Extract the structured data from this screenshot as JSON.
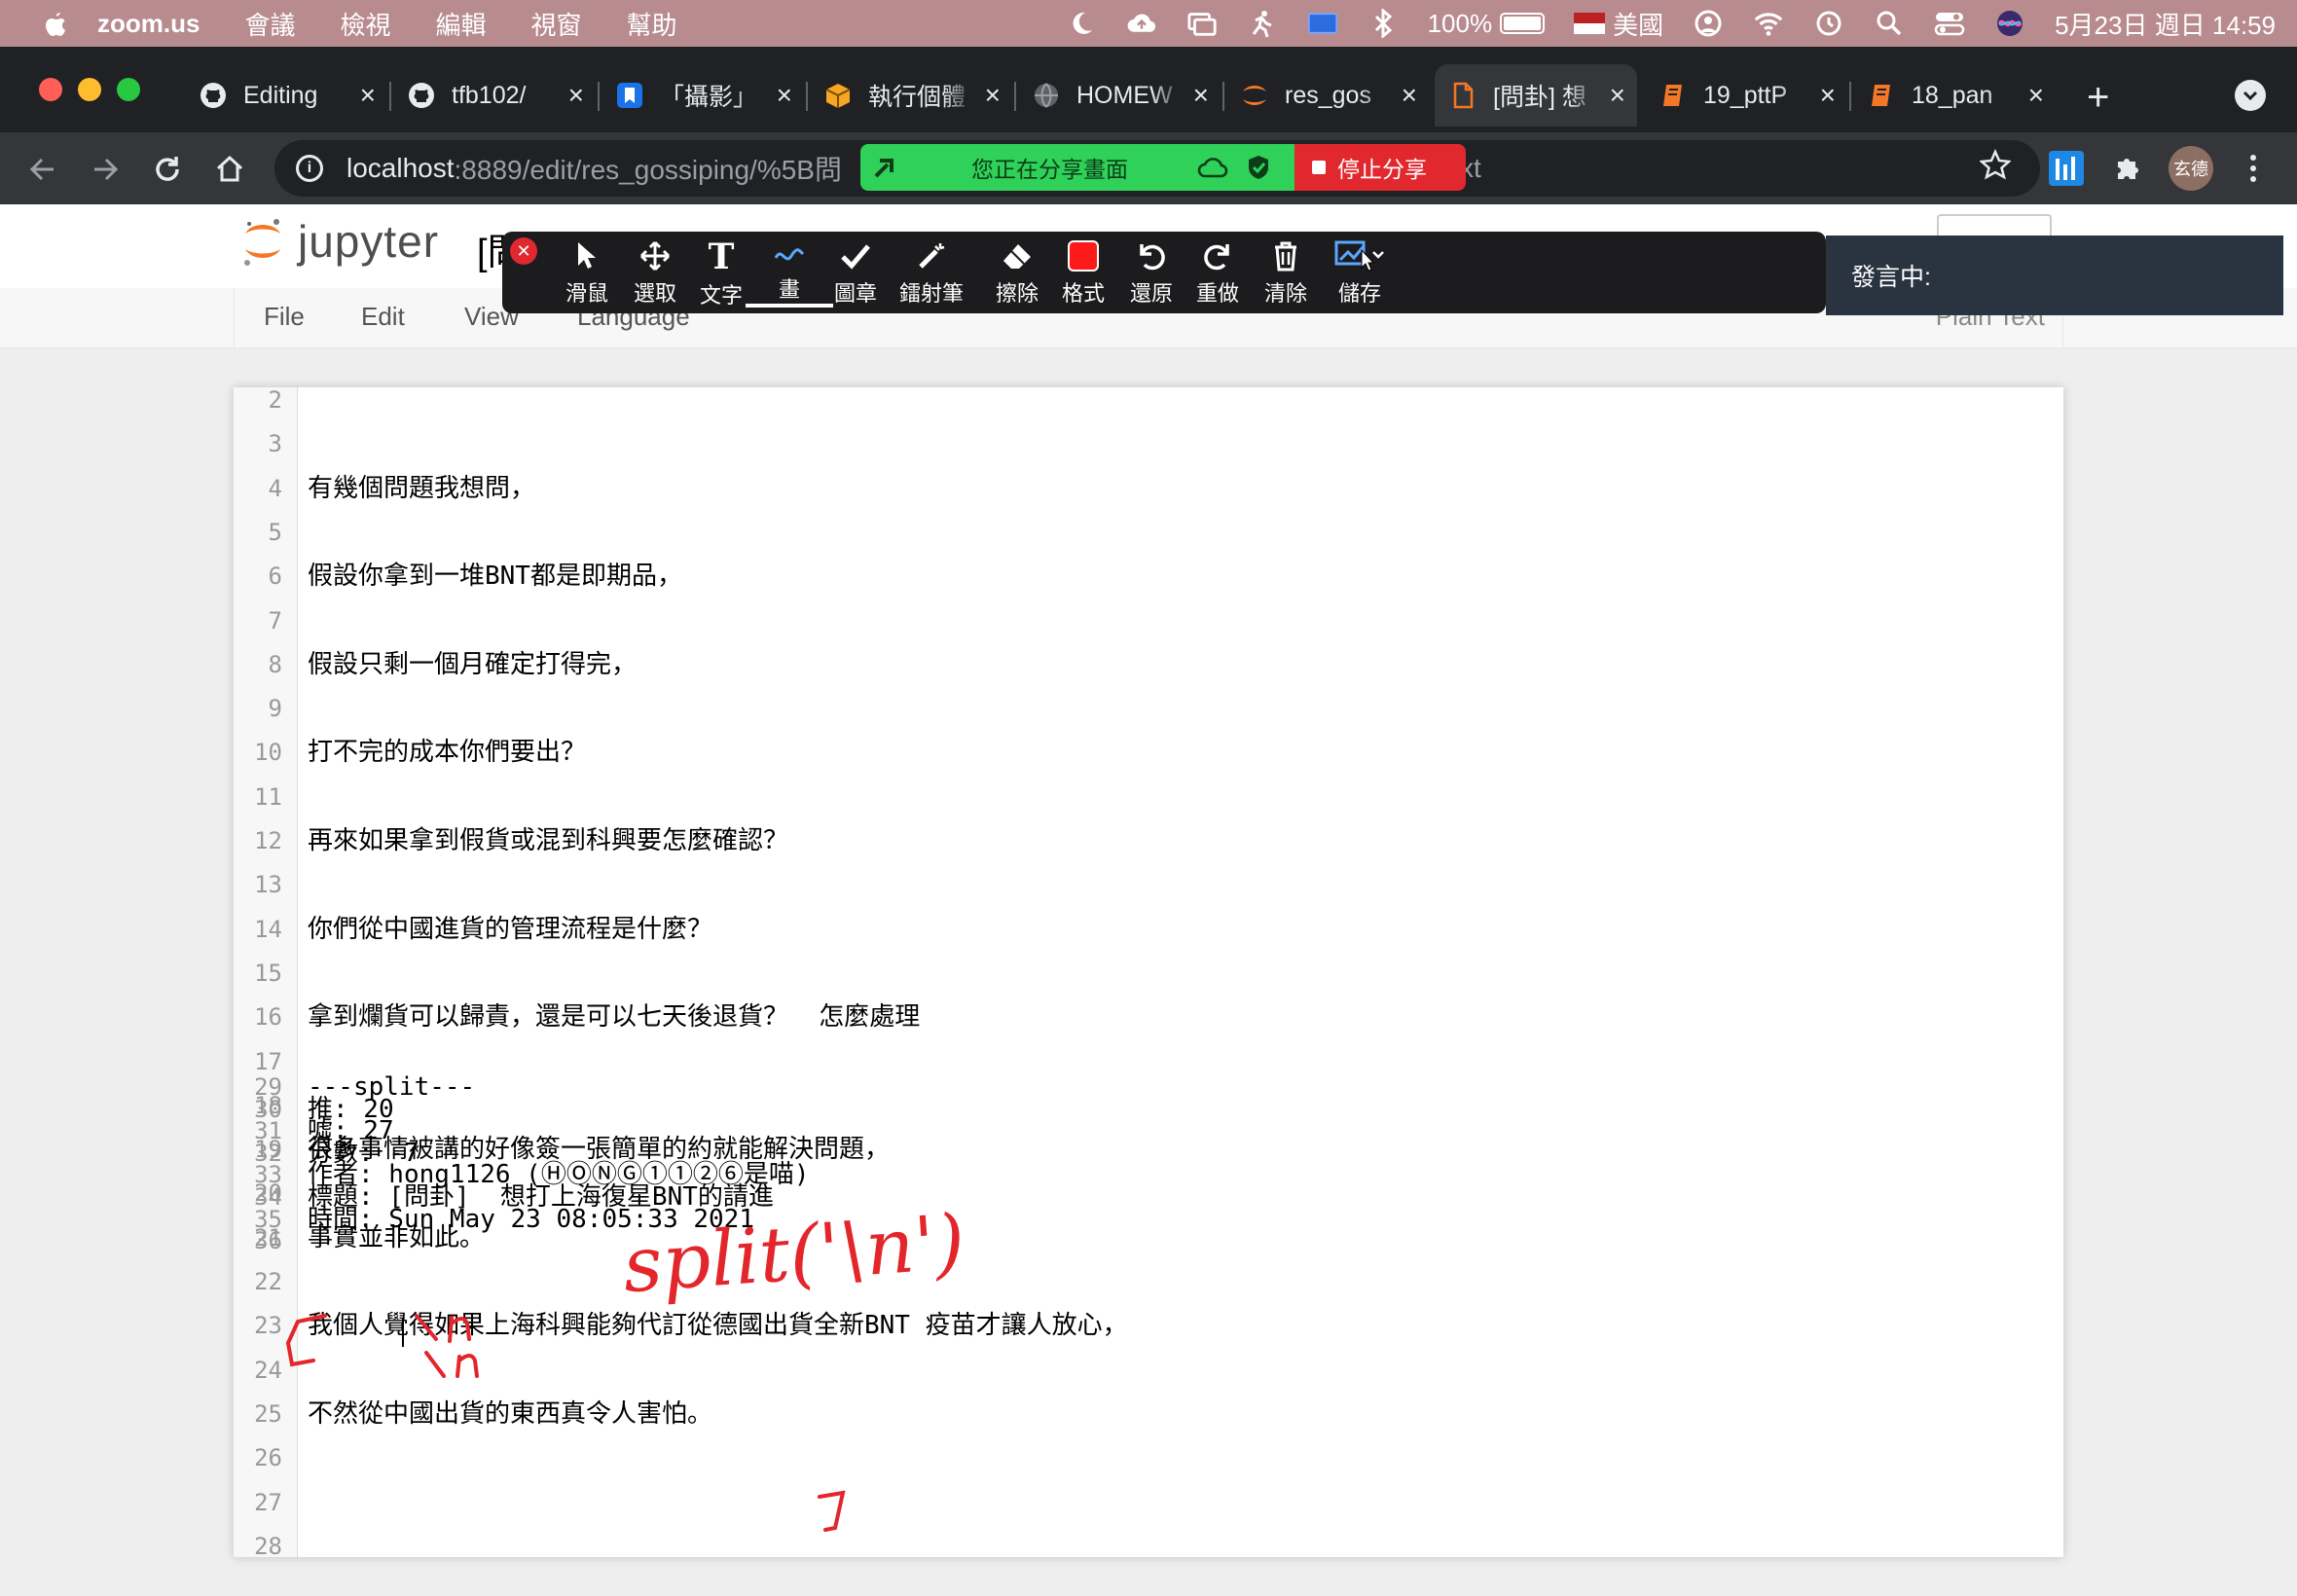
{
  "menubar": {
    "app": "zoom.us",
    "items": [
      "會議",
      "檢視",
      "編輯",
      "視窗",
      "幫助"
    ],
    "battery": "100%",
    "input_source": "美國",
    "datetime": "5月23日 週日 14:59"
  },
  "browser": {
    "tabs": [
      {
        "title": "Editing",
        "icon": "github-icon",
        "color": "#e8eaed"
      },
      {
        "title": "tfb102/",
        "icon": "github-icon",
        "color": "#e8eaed"
      },
      {
        "title": "「攝影」",
        "icon": "bookmark-app-icon",
        "color": "#1a73e8"
      },
      {
        "title": "執行個體",
        "icon": "package-icon",
        "color": "#f5a623"
      },
      {
        "title": "HOMEW",
        "icon": "globe-icon",
        "color": "#5f6368"
      },
      {
        "title": "res_gos",
        "icon": "jupyter-icon",
        "color": "#f37726"
      },
      {
        "title": "[問卦] 想",
        "icon": "document-icon",
        "color": "#f37726"
      },
      {
        "title": "19_pttP",
        "icon": "notebook-icon",
        "color": "#f37726"
      },
      {
        "title": "18_pan",
        "icon": "notebook-icon",
        "color": "#f37726"
      }
    ],
    "active_tab": 6,
    "url_host": "localhost",
    "url_path": ":8889/edit/res_gossiping/%5B問",
    "url_tail": "xt",
    "avatar_text": "玄德"
  },
  "share_banner": {
    "status": "您正在分享畫面",
    "stop_label": "停止分享"
  },
  "jupyter": {
    "logo_text": "jupyter",
    "title": "[問卦] 想打上海復星BNT的請進！！",
    "menu": [
      "File",
      "Edit",
      "View",
      "Language"
    ],
    "mode": "Plain Text"
  },
  "annotation_tools": [
    {
      "label": "滑鼠",
      "icon": "pointer-icon"
    },
    {
      "label": "選取",
      "icon": "move-icon"
    },
    {
      "label": "文字",
      "icon": "text-icon"
    },
    {
      "label": "畫",
      "icon": "draw-icon"
    },
    {
      "label": "圖章",
      "icon": "stamp-check-icon"
    },
    {
      "label": "鐳射筆",
      "icon": "laser-pen-icon"
    },
    {
      "label": "擦除",
      "icon": "eraser-icon"
    },
    {
      "label": "格式",
      "icon": "format-color-icon"
    },
    {
      "label": "還原",
      "icon": "undo-icon"
    },
    {
      "label": "重做",
      "icon": "redo-icon"
    },
    {
      "label": "清除",
      "icon": "trash-icon"
    },
    {
      "label": "儲存",
      "icon": "save-icon"
    }
  ],
  "active_tool": 3,
  "format_color": "#ff1a1a",
  "speaking_label": "發言中:",
  "editor_lines": [
    {
      "n": "2",
      "text": ""
    },
    {
      "n": "3",
      "text": ""
    },
    {
      "n": "4",
      "text": "有幾個問題我想問，"
    },
    {
      "n": "5",
      "text": ""
    },
    {
      "n": "6",
      "text": "假設你拿到一堆BNT都是即期品，"
    },
    {
      "n": "7",
      "text": ""
    },
    {
      "n": "8",
      "text": "假設只剩一個月確定打得完，"
    },
    {
      "n": "9",
      "text": ""
    },
    {
      "n": "10",
      "text": "打不完的成本你們要出？"
    },
    {
      "n": "11",
      "text": ""
    },
    {
      "n": "12",
      "text": "再來如果拿到假貨或混到科興要怎麼確認？"
    },
    {
      "n": "13",
      "text": ""
    },
    {
      "n": "14",
      "text": "你們從中國進貨的管理流程是什麼？"
    },
    {
      "n": "15",
      "text": ""
    },
    {
      "n": "16",
      "text": "拿到爛貨可以歸責，還是可以七天後退貨？  怎麼處理"
    },
    {
      "n": "17",
      "text": ""
    },
    {
      "n": "18",
      "text": ""
    },
    {
      "n": "19",
      "text": "很多事情被講的好像簽一張簡單的約就能解決問題，"
    },
    {
      "n": "20",
      "text": ""
    },
    {
      "n": "21",
      "text": "事實並非如此。"
    },
    {
      "n": "22",
      "text": ""
    },
    {
      "n": "23",
      "text": "我個人覺得如果上海科興能夠代訂從德國出貨全新BNT 疫苗才讓人放心，"
    },
    {
      "n": "24",
      "text": ""
    },
    {
      "n": "25",
      "text": "不然從中國出貨的東西真令人害怕。"
    },
    {
      "n": "26",
      "text": ""
    },
    {
      "n": "27",
      "text": ""
    },
    {
      "n": "28",
      "text": ""
    },
    {
      "n": "29",
      "text": "---split---"
    },
    {
      "n": "30",
      "text": "推: 20"
    },
    {
      "n": "31",
      "text": "噓: 27"
    },
    {
      "n": "32",
      "text": "分數: -7"
    },
    {
      "n": "33",
      "text": "作者: hong1126 (ⒽⓄⓃⒼ①①②⑥是喵)"
    },
    {
      "n": "34",
      "text": "標題: [問卦]  想打上海復星BNT的請進"
    },
    {
      "n": "35",
      "text": "時間: Sun May 23 08:05:33 2021"
    },
    {
      "n": "36",
      "text": ""
    }
  ],
  "handwriting": "split('\\n')"
}
